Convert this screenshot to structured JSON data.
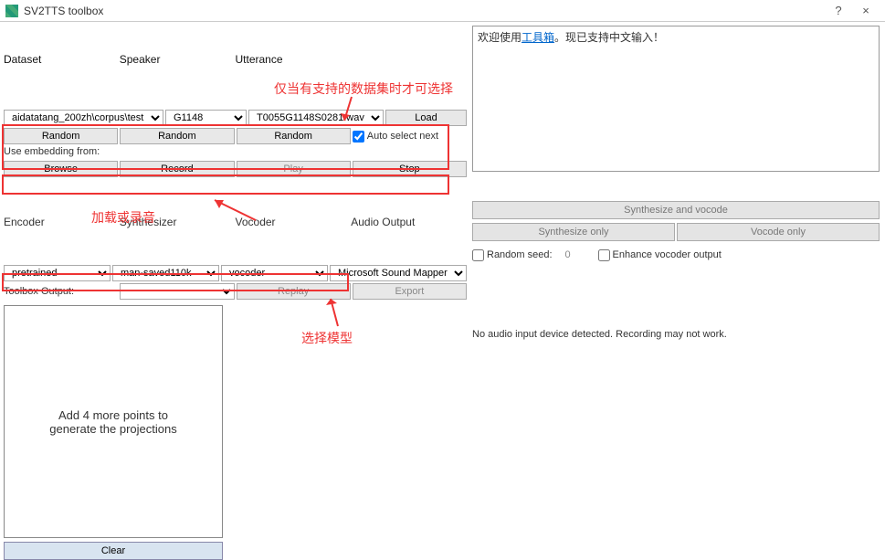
{
  "window": {
    "title": "SV2TTS toolbox",
    "help": "?",
    "close": "×"
  },
  "headers": {
    "dataset": "Dataset",
    "speaker": "Speaker",
    "utterance": "Utterance"
  },
  "selects": {
    "dataset": "aidatatang_200zh\\corpus\\test",
    "speaker": "G1148",
    "utterance": "T0055G1148S0281.wav",
    "audio_output": "Microsoft Sound Mapper"
  },
  "buttons": {
    "load": "Load",
    "random1": "Random",
    "random2": "Random",
    "random3": "Random",
    "browse": "Browse",
    "record": "Record",
    "play": "Play",
    "stop": "Stop",
    "replay": "Replay",
    "export": "Export",
    "clear": "Clear",
    "synth_vocode": "Synthesize and vocode",
    "synth_only": "Synthesize only",
    "vocode_only": "Vocode only"
  },
  "checkboxes": {
    "auto_select_next": {
      "label": "Auto select next",
      "checked": true
    },
    "random_seed": {
      "label": "Random seed:",
      "checked": false,
      "value": "0"
    },
    "enhance": {
      "label": "Enhance vocoder output",
      "checked": false
    }
  },
  "labels": {
    "use_embedding": "Use embedding from:",
    "encoder": "Encoder",
    "synthesizer": "Synthesizer",
    "vocoder": "Vocoder",
    "audio_output": "Audio Output",
    "toolbox_output": "Toolbox Output:"
  },
  "models": {
    "encoder": "pretrained",
    "synthesizer": "man-saved110k",
    "vocoder": "vocoder",
    "toolbox": ""
  },
  "annotations": {
    "a1": "仅当有支持的数据集时才可选择",
    "a2": "加载或录音",
    "a3": "选择模型"
  },
  "log": {
    "prefix": "欢迎使用",
    "link": "工具箱",
    "suffix": "。现已支持中文输入！"
  },
  "status": "No audio input device detected. Recording may not work.",
  "outbox": "Add 4 more points to\ngenerate the projections"
}
